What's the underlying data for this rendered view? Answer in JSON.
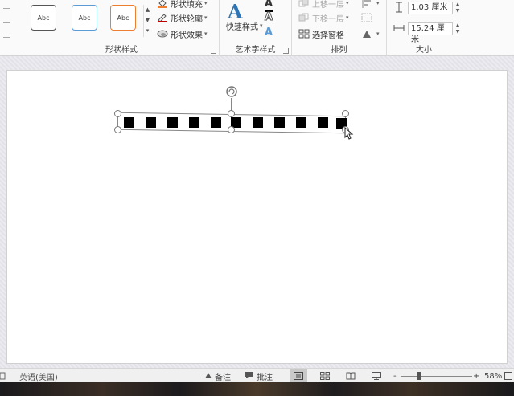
{
  "ribbon": {
    "shape_styles": {
      "swatches": [
        "Abc",
        "Abc",
        "Abc"
      ],
      "swatch_colors": [
        "#555555",
        "#5b9bd5",
        "#ed7d31"
      ],
      "fill_label": "形状填充",
      "outline_label": "形状轮廓",
      "effects_label": "形状效果",
      "group_label": "形状样式"
    },
    "wordart": {
      "quick_styles_label": "快速样式",
      "group_label": "艺术字样式",
      "text_fill_color": "#000000",
      "text_outline_color": "#888888",
      "text_effect_color": "#2e75b6"
    },
    "arrange": {
      "bring_forward_label": "上移一层",
      "send_backward_label": "下移一层",
      "selection_pane_label": "选择窗格",
      "group_label": "排列"
    },
    "size": {
      "height_value": "1.03 厘米",
      "width_value": "15.24 厘米",
      "group_label": "大小"
    }
  },
  "status_bar": {
    "language": "英语(美国)",
    "notes_label": "备注",
    "comments_label": "批注",
    "zoom_level": "58%",
    "zoom_minus": "-",
    "zoom_plus": "+"
  }
}
